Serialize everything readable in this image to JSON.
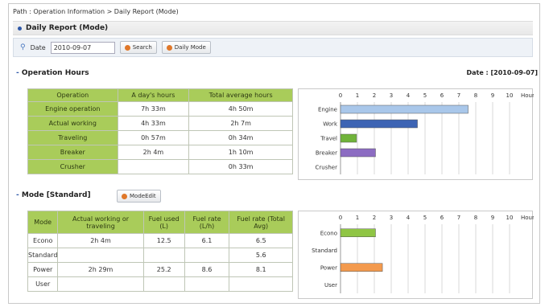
{
  "breadcrumb": "Path : Operation Information > Daily Report (Mode)",
  "page_title": "Daily Report (Mode)",
  "search": {
    "date_label": "Date",
    "date_value": "2010-09-07",
    "search_button": "Search",
    "daily_mode_button": "Daily Mode"
  },
  "operation_hours": {
    "title": "Operation Hours",
    "date_display": "Date : [2010-09-07]",
    "headers": [
      "Operation",
      "A day's hours",
      "Total average hours"
    ],
    "rows": [
      [
        "Engine operation",
        "7h 33m",
        "4h 50m"
      ],
      [
        "Actual working",
        "4h 33m",
        "2h 7m"
      ],
      [
        "Traveling",
        "0h 57m",
        "0h 34m"
      ],
      [
        "Breaker",
        "2h 4m",
        "1h 10m"
      ],
      [
        "Crusher",
        "",
        "0h 33m"
      ]
    ]
  },
  "mode": {
    "title": "Mode [Standard]",
    "edit_button": "ModeEdit",
    "headers": [
      "Mode",
      "Actual working or traveling",
      "Fuel used (L)",
      "Fuel rate (L/h)",
      "Fuel rate (Total Avg)"
    ],
    "rows": [
      [
        "Econo",
        "2h 4m",
        "12.5",
        "6.1",
        "6.5"
      ],
      [
        "Standard",
        "",
        "",
        "",
        "5.6"
      ],
      [
        "Power",
        "2h 29m",
        "25.2",
        "8.6",
        "8.1"
      ],
      [
        "User",
        "",
        "",
        "",
        ""
      ]
    ]
  },
  "chart_data": [
    {
      "type": "bar",
      "orientation": "horizontal",
      "categories": [
        "Engine",
        "Work",
        "Travel",
        "Breaker",
        "Crusher"
      ],
      "values": [
        7.55,
        4.55,
        0.95,
        2.07,
        0
      ],
      "colors": [
        "#a9c7ea",
        "#3d64b4",
        "#70b33a",
        "#8c6cc2",
        "#cccccc"
      ],
      "x_ticks": [
        "0",
        "1",
        "2",
        "3",
        "4",
        "5",
        "6",
        "7",
        "8",
        "9",
        "10"
      ],
      "unit": "Hour",
      "xlim": [
        0,
        10
      ],
      "grid": true
    },
    {
      "type": "bar",
      "orientation": "horizontal",
      "categories": [
        "Econo",
        "Standard",
        "Power",
        "User"
      ],
      "values": [
        2.07,
        0,
        2.48,
        0
      ],
      "colors": [
        "#8fc544",
        "#cccccc",
        "#f39a4e",
        "#cccccc"
      ],
      "x_ticks": [
        "0",
        "1",
        "2",
        "3",
        "4",
        "5",
        "6",
        "7",
        "8",
        "9",
        "10"
      ],
      "unit": "Hour",
      "xlim": [
        0,
        10
      ],
      "grid": true
    }
  ]
}
